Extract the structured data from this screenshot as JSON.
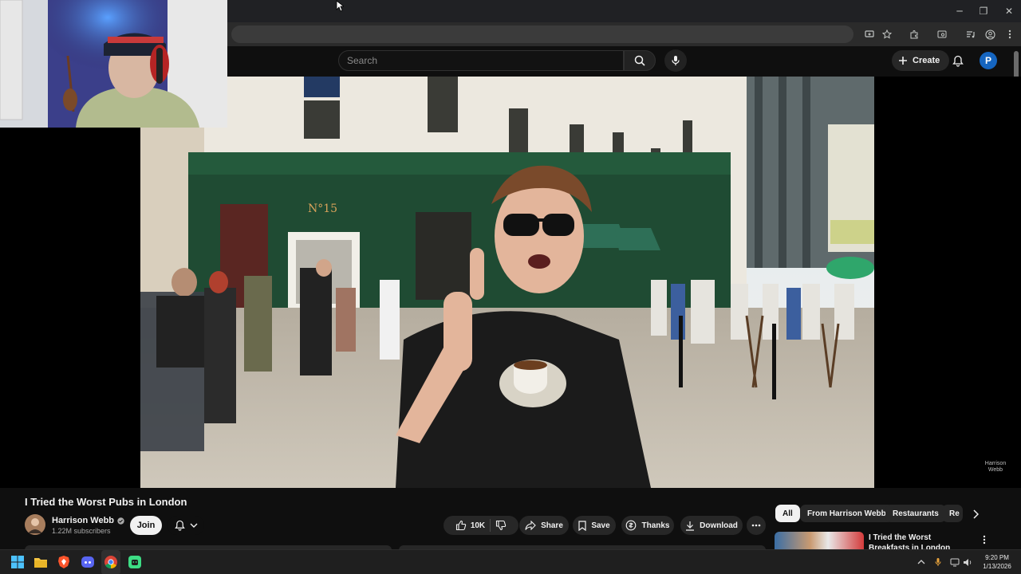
{
  "browser": {
    "window_controls": {
      "minimize": "─",
      "maximize": "❐",
      "close": "✕"
    },
    "toolbar_icons": [
      "install-icon",
      "star-icon",
      "extensions-icon",
      "tab-search-icon",
      "media-icon",
      "profile-icon",
      "menu-icon"
    ]
  },
  "masthead": {
    "search_placeholder": "Search",
    "create_label": "Create",
    "avatar_letter": "P"
  },
  "video": {
    "title": "I Tried the Worst Pubs in London",
    "watermark_line1": "Harrison",
    "watermark_line2": "Webb"
  },
  "channel": {
    "name": "Harrison Webb",
    "subscribers": "1.22M subscribers",
    "join_label": "Join"
  },
  "actions": {
    "like_count": "10K",
    "share": "Share",
    "save": "Save",
    "thanks": "Thanks",
    "download": "Download"
  },
  "chips": [
    "All",
    "From Harrison Webb",
    "Restaurants",
    "Re"
  ],
  "recommendation": {
    "title": "I Tried the Worst Breakfasts in London"
  },
  "taskbar": {
    "time": "9:20 PM",
    "date": "1/13/2026"
  }
}
